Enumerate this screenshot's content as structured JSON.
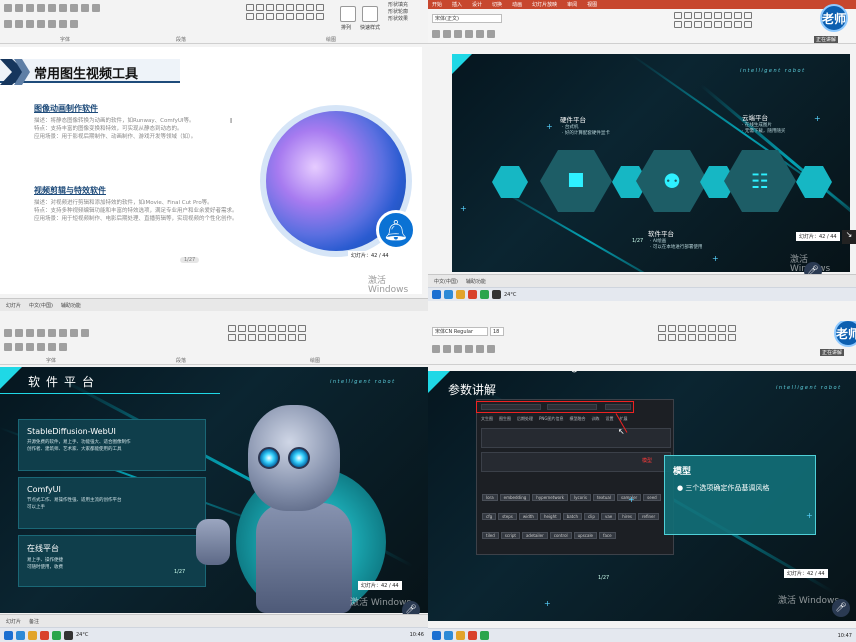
{
  "q1": {
    "ribbon_groups": [
      "字体",
      "段落",
      "绘图"
    ],
    "ribbon_side": [
      "形状填充",
      "形状轮廓",
      "形状效果"
    ],
    "ribbon_big_buttons": [
      "排列",
      "快速样式"
    ],
    "slide_title": "常用图生视频工具",
    "sec1_title": "图像动画制作软件",
    "sec1_lines": [
      "描述：将静态图像转换为动画的软件，如Runway、ComfyUI等。",
      "特点：支持丰富的图像变换和特效，可实现从静态到动态的。",
      "应用场景：用于影视后期制作、动画制作、游戏开发等领域（如）。"
    ],
    "sec2_title": "视频剪辑与特效软件",
    "sec2_lines": [
      "描述：对视频进行剪辑和添加特效的软件，如iMovie、Final Cut Pro等。",
      "特点：支持多种视频编辑功能和丰富的特效选项，满足专业用户和业余爱好者需求。",
      "应用场景：用于短视频制作、电影后期处理、直播剪辑等，实现视频的个性化创作。"
    ],
    "page": "1/27",
    "note": "幻灯片：42 / 44",
    "status": [
      "幻灯片",
      "中文(中国)",
      "辅助功能"
    ],
    "activate": "激活 Windows"
  },
  "q2": {
    "ribbon_text": [
      "宋体(正文)",
      "开始",
      "插入",
      "设计",
      "切换",
      "动画",
      "幻灯片放映",
      "审阅",
      "视图",
      "帮助"
    ],
    "teacher": "老师",
    "teacher_label": "正在讲解",
    "ai_text": "intelligent robot",
    "node1_title": "硬件平台",
    "node1_sub": [
      "· 台式机",
      "· 好的计算配套硬件显卡"
    ],
    "node2_title": "云端平台",
    "node2_sub": [
      "· 在线生成图片",
      "· 无需下载，随用随买"
    ],
    "node3_title": "软件平台",
    "node3_sub": [
      "· AI绘画",
      "· 可以在本地进行部署使用"
    ],
    "page": "1/27",
    "note": "幻灯片：42 / 44",
    "activate": "激活 Windows",
    "status": [
      "中文(中国)",
      "辅助功能"
    ]
  },
  "q3": {
    "ribbon_groups": [
      "字体",
      "段落",
      "绘图"
    ],
    "title": "软件平台",
    "ai_text": "intelligent robot",
    "cards": [
      {
        "title": "StableDiffusion-WebUI",
        "desc": [
          "开源免费的软件，易上手、功能强大、适合图像制作",
          "创作者、建筑师、艺术家、大家都能使用的工具"
        ]
      },
      {
        "title": "ComfyUI",
        "desc": [
          "节点式工作、易操作性强、适用主流的创作平台",
          "可以上手"
        ]
      },
      {
        "title": "在线平台",
        "desc": [
          "易上手、操作便捷",
          "可随时使用，收费"
        ]
      }
    ],
    "page": "1/27",
    "note": "幻灯片：42 / 44",
    "activate": "激活 Windows",
    "status": [
      "幻灯片",
      "备注"
    ]
  },
  "q4": {
    "ribbon_text": [
      "宋体CN Regular",
      "18"
    ],
    "teacher": "老师",
    "teacher_label": "正在讲解",
    "title": "参数讲解",
    "ai_text": "intelligent robot",
    "model_title": "模型",
    "model_item": "三个选项确定作品基调风格",
    "red_label": "模型",
    "win_tabs": [
      "文生图",
      "图生图",
      "后期处理",
      "PNG图片信息",
      "模型融合",
      "训练",
      "设置",
      "扩展"
    ],
    "win_pills": [
      "lora",
      "embedding",
      "hypernetwork",
      "lycoris",
      "textual",
      "sampler",
      "seed",
      "cfg",
      "steps",
      "width",
      "height",
      "batch",
      "clip",
      "vae",
      "hires",
      "refiner",
      "tiled",
      "script",
      "adetailer",
      "control",
      "upscale",
      "face"
    ],
    "page": "1/27",
    "note": "幻灯片：42 / 44",
    "activate": "激活 Windows"
  },
  "taskbar": {
    "temp": "24°C",
    "time1": "10:46",
    "date1": "2024/5/3",
    "time2": "10:47",
    "date2": "2024/5/3"
  }
}
